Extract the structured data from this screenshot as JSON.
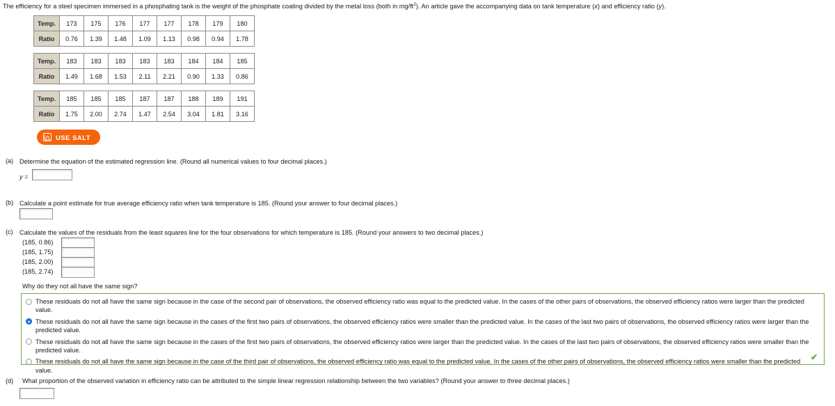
{
  "intro": {
    "part1": "The efficiency for a steel specimen immersed in a phosphating tank is the weight of the phosphate coating divided by the metal loss (both in mg/ft",
    "sup": "2",
    "part2": "). An article gave the accompanying data on tank temperature (",
    "var_x": "x",
    "part3": ") and efficiency ratio (",
    "var_y": "y",
    "part4": ")."
  },
  "tables": {
    "row_header_temp": "Temp.",
    "row_header_ratio": "Ratio",
    "blocks": [
      {
        "temp": [
          "173",
          "175",
          "176",
          "177",
          "177",
          "178",
          "179",
          "180"
        ],
        "ratio": [
          "0.76",
          "1.39",
          "1.48",
          "1.09",
          "1.13",
          "0.98",
          "0.94",
          "1.78"
        ]
      },
      {
        "temp": [
          "183",
          "183",
          "183",
          "183",
          "183",
          "184",
          "184",
          "185"
        ],
        "ratio": [
          "1.49",
          "1.68",
          "1.53",
          "2.11",
          "2.21",
          "0.90",
          "1.33",
          "0.86"
        ]
      },
      {
        "temp": [
          "185",
          "185",
          "185",
          "187",
          "187",
          "188",
          "189",
          "191"
        ],
        "ratio": [
          "1.75",
          "2.00",
          "2.74",
          "1.47",
          "2.54",
          "3.04",
          "1.81",
          "3.16"
        ]
      }
    ]
  },
  "salt_button": {
    "label": "USE SALT",
    "color": "#f4640d"
  },
  "parts": {
    "a": {
      "tag": "(a)",
      "prompt": "Determine the equation of the estimated regression line. (Round all numerical values to four decimal places.)",
      "y_label": "y =",
      "answer": "",
      "placeholder": ""
    },
    "b": {
      "tag": "(b)",
      "prompt": "Calculate a point estimate for true average efficiency ratio when tank temperature is 185. (Round your answer to four decimal places.)",
      "answer": "",
      "placeholder": ""
    },
    "c": {
      "tag": "(c)",
      "prompt": "Calculate the values of the residuals from the least squares line for the four observations for which temperature is 185. (Round your answers to two decimal places.)",
      "rows": [
        {
          "label": "(185, 0.86)",
          "answer": ""
        },
        {
          "label": "(185, 1.75)",
          "answer": ""
        },
        {
          "label": "(185, 2.00)",
          "answer": ""
        },
        {
          "label": "(185, 2.74)",
          "answer": ""
        }
      ],
      "why_prompt": "Why do they not all have the same sign?",
      "options": [
        {
          "text": "These residuals do not all have the same sign because in the case of the second pair of observations, the observed efficiency ratio was equal to the predicted value. In the cases of the other pairs of observations, the observed efficiency ratios were larger than the predicted value.",
          "selected": false
        },
        {
          "text": "These residuals do not all have the same sign because in the cases of the first two pairs of observations, the observed efficiency ratios were smaller than the predicted value. In the cases of the last two pairs of observations, the observed efficiency ratios were larger than the predicted value.",
          "selected": true
        },
        {
          "text": "These residuals do not all have the same sign because in the cases of the first two pairs of observations, the observed efficiency ratios were larger than the predicted value. In the cases of the last two pairs of observations, the observed efficiency ratios were smaller than the predicted value.",
          "selected": false
        },
        {
          "text": "These residuals do not all have the same sign because in the case of the third pair of observations, the observed efficiency ratio was equal to the predicted value. In the cases of the other pairs of observations, the observed efficiency ratios were smaller than the predicted value.",
          "selected": false
        }
      ],
      "correct_mark": "✔",
      "correct_color": "#5faa3f"
    },
    "d": {
      "tag": "(d)",
      "prompt": "What proportion of the observed variation in efficiency ratio can be attributed to the simple linear regression relationship between the two variables? (Round your answer to three decimal places.)",
      "answer": "",
      "placeholder": ""
    }
  }
}
